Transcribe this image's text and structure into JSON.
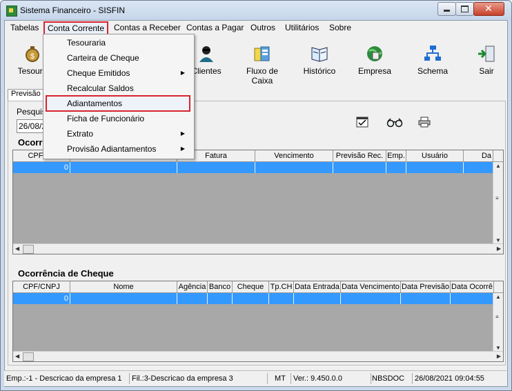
{
  "window": {
    "title": "Sistema Financeiro - SISFIN"
  },
  "menubar": {
    "items": [
      {
        "label": "Tabelas"
      },
      {
        "label": "Conta Corrente"
      },
      {
        "label": "Contas a Receber"
      },
      {
        "label": "Contas a Pagar"
      },
      {
        "label": "Outros"
      },
      {
        "label": "Utilitários"
      },
      {
        "label": "Sobre"
      }
    ]
  },
  "toolbar": {
    "buttons": [
      {
        "label": "Tesoura",
        "icon": "money-bag-icon"
      },
      {
        "label": "Clientes",
        "icon": "person-icon"
      },
      {
        "label": "Fluxo de Caixa",
        "icon": "cash-flow-icon"
      },
      {
        "label": "Histórico",
        "icon": "book-icon"
      },
      {
        "label": "Empresa",
        "icon": "globe-icon"
      },
      {
        "label": "Schema",
        "icon": "schema-icon"
      },
      {
        "label": "Sair",
        "icon": "exit-door-icon"
      }
    ]
  },
  "tabs": {
    "active_label": "Previsão c"
  },
  "panel": {
    "search_label": "Pesquisa",
    "date_value": "26/08/2"
  },
  "grid1": {
    "title": "Ocorr",
    "headers": [
      "CPF / C",
      "",
      "Fatura",
      "Vencimento",
      "Previsão Rec.",
      "Emp.",
      "Usuário",
      "Da"
    ],
    "row": [
      "0"
    ]
  },
  "grid2": {
    "title": "Ocorrência de Cheque",
    "headers": [
      "CPF/CNPJ",
      "Nome",
      "Agência",
      "Banco",
      "Cheque",
      "Tp.CH",
      "Data Entrada",
      "Data Vencimento",
      "Data Previsão",
      "Data Ocorrê"
    ],
    "row": [
      "0"
    ]
  },
  "dropdown": {
    "items": [
      {
        "label": "Tesouraria",
        "submenu": false
      },
      {
        "label": "Carteira de Cheque",
        "submenu": false
      },
      {
        "label": "Cheque Emitidos",
        "submenu": true
      },
      {
        "label": "Recalcular Saldos",
        "submenu": false
      },
      {
        "label": "Adiantamentos",
        "submenu": false
      },
      {
        "label": "Ficha de Funcionário",
        "submenu": false
      },
      {
        "label": "Extrato",
        "submenu": true
      },
      {
        "label": "Provisão Adiantamentos",
        "submenu": true
      }
    ]
  },
  "status": {
    "empresa": "Emp.:-1 - Descricao da empresa 1",
    "filial": "Fil.:3-Descricao da empresa 3",
    "uf": "MT",
    "versao": "Ver.: 9.450.0.0",
    "modulo": "NBSDOC",
    "datetime": "26/08/2021 09:04:55"
  },
  "colors": {
    "selection": "#3399ff",
    "highlight_border": "#d9232d"
  }
}
